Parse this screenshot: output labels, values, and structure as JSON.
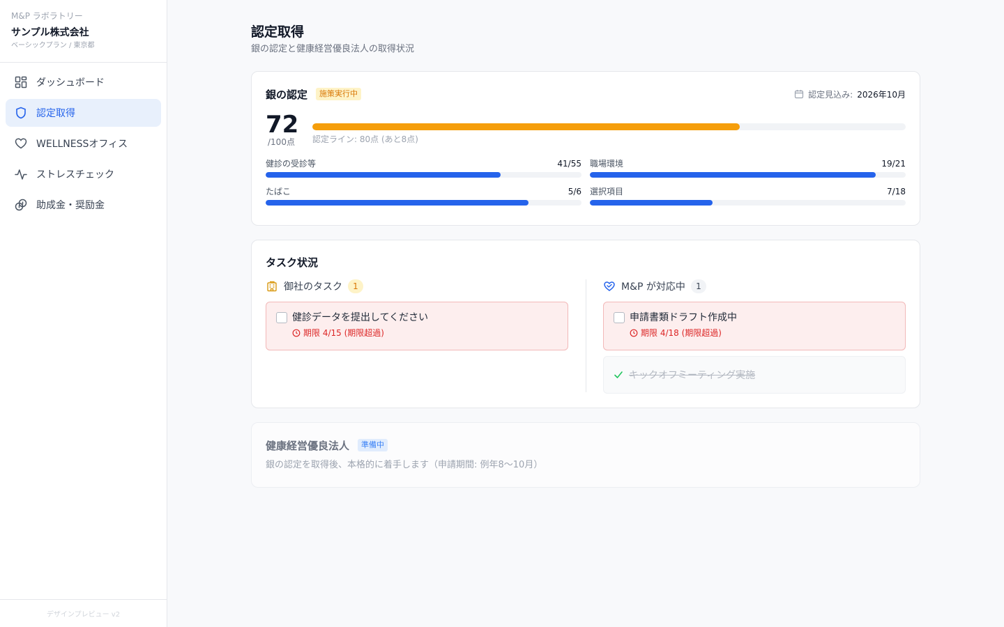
{
  "sidebar": {
    "org_lab": "M&P ラボラトリー",
    "org_name": "サンプル株式会社",
    "org_plan": "ベーシックプラン / 東京都",
    "items": [
      {
        "label": "ダッシュボード",
        "icon": "dashboard-icon"
      },
      {
        "label": "認定取得",
        "icon": "shield-icon"
      },
      {
        "label": "WELLNESSオフィス",
        "icon": "heart-icon"
      },
      {
        "label": "ストレスチェック",
        "icon": "pulse-icon"
      },
      {
        "label": "助成金・奨励金",
        "icon": "coins-icon"
      }
    ],
    "active_index": 1,
    "footer": "デザインプレビュー v2"
  },
  "header": {
    "title": "認定取得",
    "subtitle": "銀の認定と健康経営優良法人の取得状況"
  },
  "silver": {
    "title": "銀の認定",
    "badge": "施策実行中",
    "date_label": "認定見込み:",
    "date_value": "2026年10月",
    "score": "72",
    "score_unit": "/100点",
    "score_fraction": 0.72,
    "score_note": "認定ライン: 80点 (あと8点)",
    "score_color": "#f59e0b",
    "metric_color": "#2563eb",
    "metrics": [
      {
        "label": "健診の受診等",
        "value": "41/55",
        "fraction": 0.745
      },
      {
        "label": "職場環境",
        "value": "19/21",
        "fraction": 0.905
      },
      {
        "label": "たばこ",
        "value": "5/6",
        "fraction": 0.833
      },
      {
        "label": "選択項目",
        "value": "7/18",
        "fraction": 0.389
      }
    ]
  },
  "tasks": {
    "title": "タスク状況",
    "company": {
      "label": "御社のタスク",
      "count": "1",
      "items": [
        {
          "title": "健診データを提出してください",
          "due": "期限 4/15 (期限超過)"
        }
      ]
    },
    "mp": {
      "label": "M&P が対応中",
      "count": "1",
      "items": [
        {
          "title": "申請書類ドラフト作成中",
          "due": "期限 4/18 (期限超過)"
        }
      ],
      "done": [
        {
          "title": "キックオフミーティング実施"
        }
      ]
    }
  },
  "kenko": {
    "title": "健康経営優良法人",
    "badge": "準備中",
    "desc": "銀の認定を取得後、本格的に着手します（申請期間: 例年8〜10月）"
  }
}
